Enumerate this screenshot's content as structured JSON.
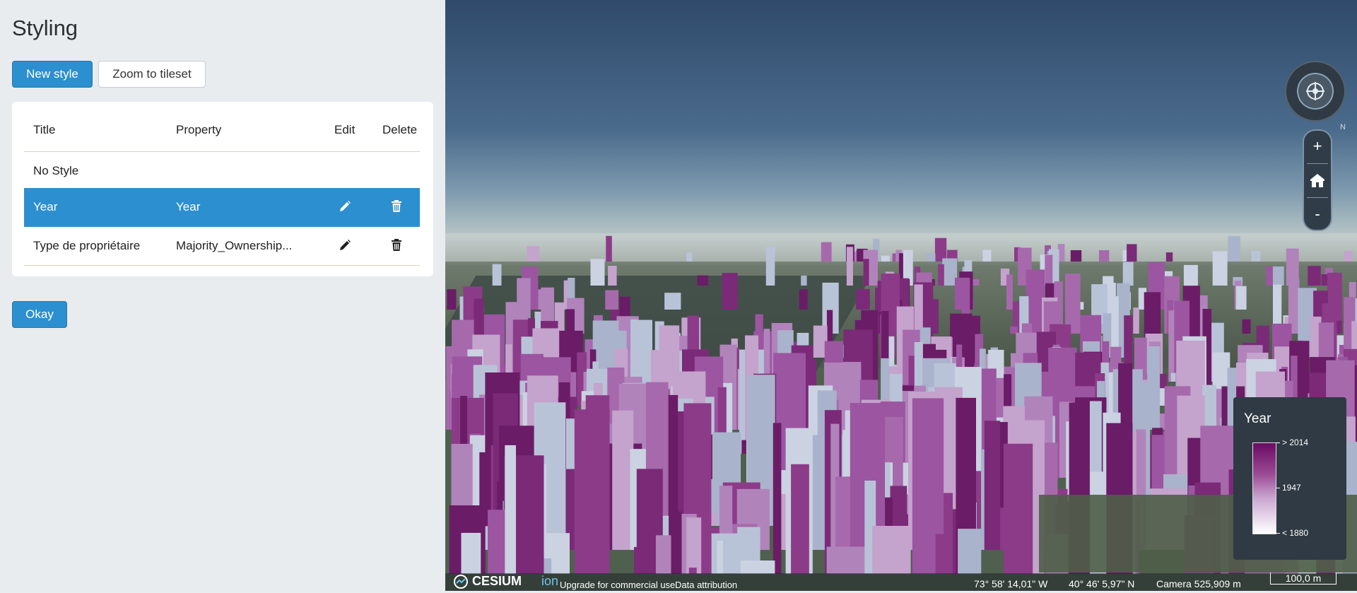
{
  "panel": {
    "title": "Styling",
    "new_style_label": "New style",
    "zoom_label": "Zoom to tileset",
    "okay_label": "Okay"
  },
  "table": {
    "headers": [
      "Title",
      "Property",
      "Edit",
      "Delete"
    ],
    "rows": [
      {
        "title": "No Style",
        "property": "",
        "editable": false
      },
      {
        "title": "Year",
        "property": "Year",
        "editable": true,
        "selected": true
      },
      {
        "title": "Type de propriétaire",
        "property": "Majority_Ownership...",
        "editable": true
      }
    ]
  },
  "viewer": {
    "legend": {
      "title": "Year",
      "max_label": "> 2014",
      "mid_label": "1947",
      "min_label": "< 1880"
    },
    "credits": {
      "logo": "CESIUM",
      "logo_suffix": "ion",
      "upgrade": "Upgrade for commercial use.",
      "attribution": "Data attribution"
    },
    "status": {
      "longitude": "73° 58' 14,01\" W",
      "latitude": "40° 46' 5,97\" N",
      "camera": "Camera 525,909 m",
      "scale": "100,0 m"
    },
    "compass_north": "N",
    "zoom_in": "+",
    "zoom_out": "-"
  },
  "colors": {
    "accent": "#2c8fcf",
    "building_dark": "#7b2a78",
    "building_light": "#b9c3d8"
  }
}
